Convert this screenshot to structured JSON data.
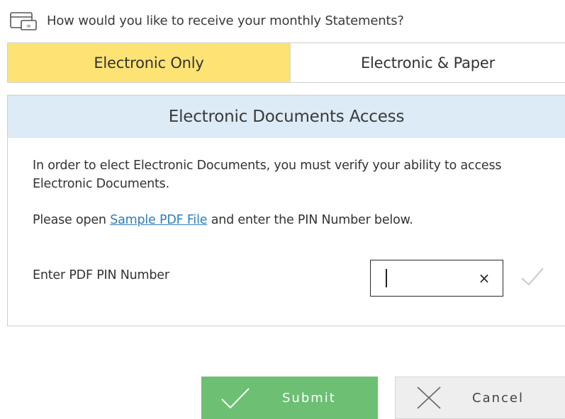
{
  "question": {
    "icon": "credit-card-icon",
    "text": "How would you like to receive your monthly Statements?"
  },
  "delivery_options": [
    {
      "label": "Electronic Only",
      "selected": true
    },
    {
      "label": "Electronic & Paper",
      "selected": false
    }
  ],
  "panel": {
    "title": "Electronic Documents Access",
    "paragraph": "In order to elect Electronic Documents, you must verify your ability to access Electronic Documents.",
    "instruction_prefix": "Please open ",
    "instruction_link": "Sample PDF File",
    "instruction_suffix": " and enter the PIN Number below.",
    "pin_label": "Enter PDF PIN Number",
    "pin_value": "",
    "clear_glyph": "×"
  },
  "actions": {
    "submit_label": "Submit",
    "cancel_label": "Cancel"
  },
  "colors": {
    "selected_option_bg": "#fde374",
    "panel_header_bg": "#dcebf5",
    "submit_bg": "#6cbf73",
    "cancel_bg": "#eeeeee",
    "link": "#2f7fb8"
  }
}
